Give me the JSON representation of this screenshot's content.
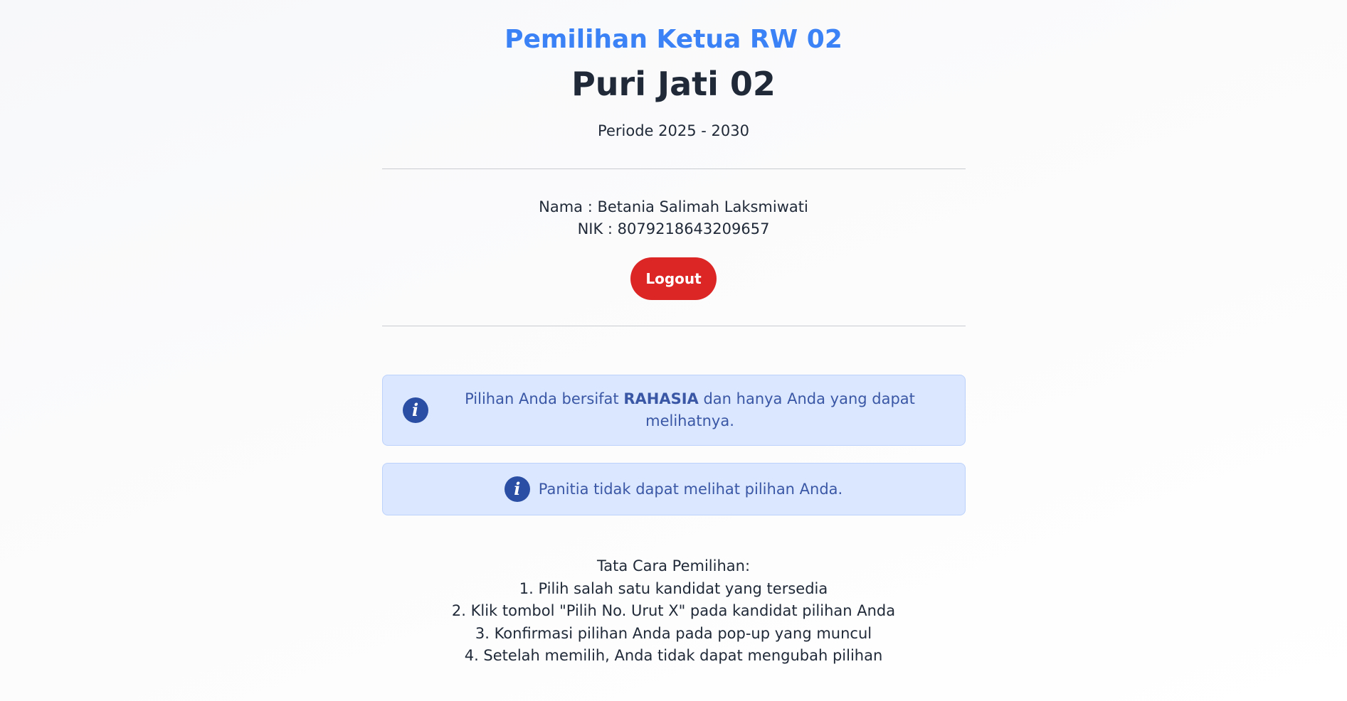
{
  "header": {
    "subtitle": "Pemilihan Ketua RW 02",
    "title": "Puri Jati 02",
    "period": "Periode 2025 - 2030"
  },
  "user": {
    "name_line": "Nama : Betania Salimah Laksmiwati",
    "nik_line": "NIK : 8079218643209657"
  },
  "actions": {
    "logout_label": "Logout"
  },
  "alerts": {
    "secret": {
      "icon": "info-icon",
      "prefix": "Pilihan Anda bersifat ",
      "emphasis": "RAHASIA",
      "suffix": " dan hanya Anda yang dapat melihatnya."
    },
    "committee": {
      "icon": "info-icon",
      "text": "Panitia tidak dapat melihat pilihan Anda."
    }
  },
  "instructions": {
    "heading": "Tata Cara Pemilihan:",
    "steps": [
      "1. Pilih salah satu kandidat yang tersedia",
      "2. Klik tombol \"Pilih No. Urut X\" pada kandidat pilihan Anda",
      "3. Konfirmasi pilihan Anda pada pop-up yang muncul",
      "4. Setelah memilih, Anda tidak dapat mengubah pilihan"
    ]
  },
  "colors": {
    "accent": "#3b82f6",
    "danger": "#dc2626",
    "alert_bg": "#dbe7fe",
    "icon_bg": "#2a4ea3"
  }
}
